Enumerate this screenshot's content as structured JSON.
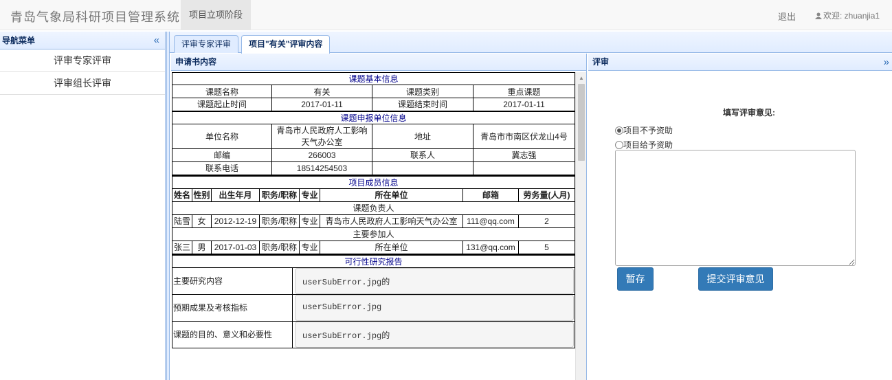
{
  "app": {
    "title": "青岛气象局科研项目管理系统",
    "stage_tab": "项目立项阶段",
    "logout": "退出",
    "welcome": "欢迎: zhuanjia1"
  },
  "sidebar": {
    "title": "导航菜单",
    "collapse": "«",
    "items": [
      {
        "label": "评审专家评审"
      },
      {
        "label": "评审组长评审"
      }
    ]
  },
  "tabs": [
    {
      "label": "评审专家评审"
    },
    {
      "label": "项目\"有关\"评审内容"
    }
  ],
  "left_panel": {
    "title": "申请书内容"
  },
  "basic": {
    "section": "课题基本信息",
    "name_label": "课题名称",
    "name_value": "有关",
    "type_label": "课题类别",
    "type_value": "重点课题",
    "start_label": "课题起止时间",
    "start_value": "2017-01-11",
    "end_label": "课题结束时间",
    "end_value": "2017-01-11"
  },
  "unit": {
    "section": "课题申报单位信息",
    "name_label": "单位名称",
    "name_value": "青岛市人民政府人工影响天气办公室",
    "addr_label": "地址",
    "addr_value": "青岛市市南区伏龙山4号",
    "zip_label": "邮编",
    "zip_value": "266003",
    "contact_label": "联系人",
    "contact_value": "冀志强",
    "phone_label": "联系电话",
    "phone_value": "18514254503"
  },
  "members": {
    "section": "项目成员信息",
    "headers": [
      "姓名",
      "性别",
      "出生年月",
      "职务/职称",
      "专业",
      "所在单位",
      "邮箱",
      "劳务量(人月)"
    ],
    "leader_section": "课题负责人",
    "leader": [
      "陆雪",
      "女",
      "2012-12-19",
      "职务/职称",
      "专业",
      "青岛市人民政府人工影响天气办公室",
      "111@qq.com",
      "2"
    ],
    "participant_section": "主要参加人",
    "participant": [
      "张三",
      "男",
      "2017-01-03",
      "职务/职称",
      "专业",
      "所在单位",
      "131@qq.com",
      "5"
    ]
  },
  "report": {
    "section": "可行性研究报告",
    "rows": [
      {
        "label": "主要研究内容",
        "value": "userSubError.jpg的"
      },
      {
        "label": "预期成果及考核指标",
        "value": "userSubError.jpg"
      },
      {
        "label": "课题的目的、意义和必要性",
        "value": "userSubError.jpg的"
      }
    ]
  },
  "right_panel": {
    "title": "评审",
    "expand": "»",
    "opinion_title": "填写评审意见:",
    "options": [
      {
        "label": "项目不予资助",
        "checked": true
      },
      {
        "label": "项目给予资助",
        "checked": false
      }
    ],
    "save_label": "暂存",
    "submit_label": "提交评审意见"
  }
}
